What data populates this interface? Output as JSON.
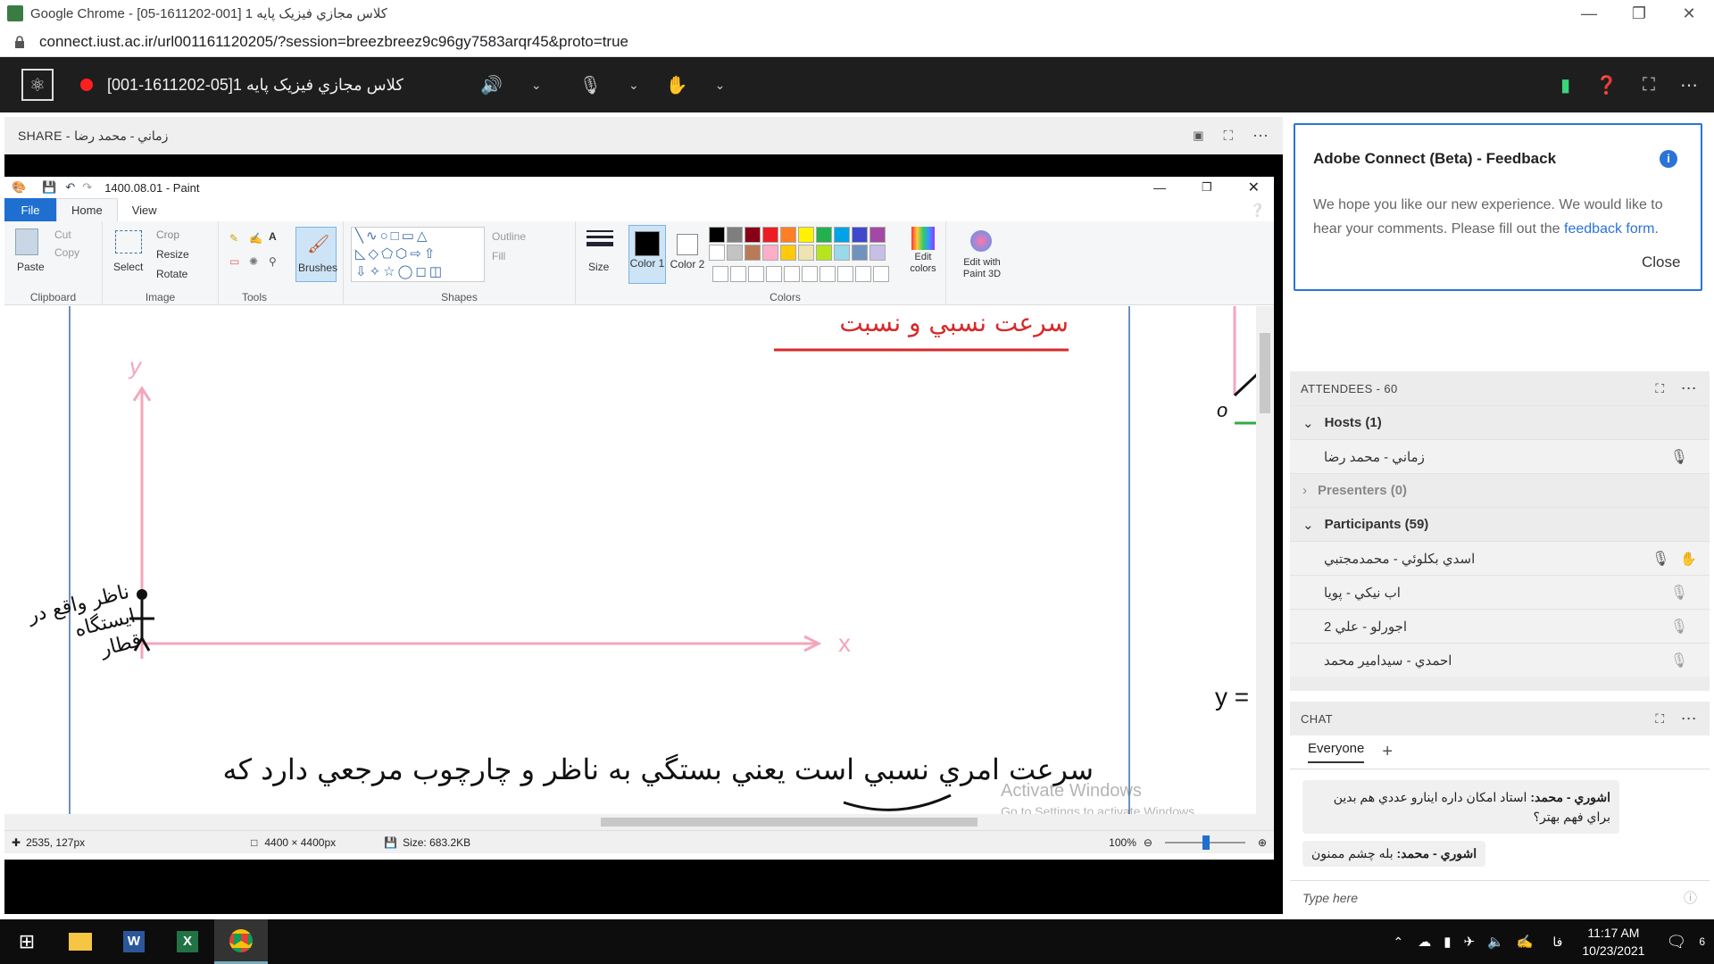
{
  "browser": {
    "title": "Google Chrome - [05-1611202-001] کلاس مجازي فيزيک پايه 1",
    "url": "connect.iust.ac.ir/url001161120205/?session=breezbreez9c96gy7583arqr45&proto=true"
  },
  "connect": {
    "room_title": "کلاس مجازي فيزيک پايه 1[05-1611202-001]",
    "share_label": "SHARE - زماني - محمد رضا"
  },
  "paint": {
    "title": "1400.08.01 - Paint",
    "menu": {
      "file": "File",
      "home": "Home",
      "view": "View"
    },
    "clipboard": {
      "paste": "Paste",
      "cut": "Cut",
      "copy": "Copy",
      "group": "Clipboard"
    },
    "image": {
      "select": "Select",
      "crop": "Crop",
      "resize": "Resize",
      "rotate": "Rotate",
      "group": "Image"
    },
    "tools": {
      "group": "Tools",
      "brushes": "Brushes"
    },
    "shapes": {
      "group": "Shapes",
      "outline": "Outline",
      "fill": "Fill"
    },
    "size": "Size",
    "color1": "Color 1",
    "color2": "Color 2",
    "colors_group": "Colors",
    "edit_colors": "Edit colors",
    "edit_paint3d": "Edit with Paint 3D",
    "palette": [
      "#000000",
      "#7f7f7f",
      "#880015",
      "#ed1c24",
      "#ff7f27",
      "#fff200",
      "#22b14c",
      "#00a2e8",
      "#3f48cc",
      "#a349a4",
      "#ffffff",
      "#c3c3c3",
      "#b97a57",
      "#ffaec9",
      "#ffc90e",
      "#efe4b0",
      "#b5e61d",
      "#99d9ea",
      "#7092be",
      "#c8bfe7"
    ],
    "status": {
      "coords": "2535, 127px",
      "dimensions": "4400 × 4400px",
      "size": "Size: 683.2KB",
      "zoom": "100%"
    },
    "watermark": {
      "line1": "Activate Windows",
      "line2": "Go to Settings to activate Windows."
    },
    "canvas_text": {
      "y_label": "y",
      "x_label": "x",
      "observer": "ناظر واقع در ايستگاه قطار",
      "bottom": "سرعت امري نسبي است يعني بستگي به ناظر و چارچوب مرجعي دارد كه",
      "top_right": "سرعت نسبي و نسبت",
      "o_label": "o",
      "y_eq": "y ="
    }
  },
  "feedback": {
    "title": "Adobe Connect (Beta) - Feedback",
    "body": "We hope you like our new experience. We would like to hear your comments. Please fill out the",
    "link": "feedback form",
    "period": ".",
    "close": "Close"
  },
  "attendees": {
    "header": "ATTENDEES - 60",
    "hosts": "Hosts (1)",
    "host_name": "زماني - محمد رضا",
    "presenters": "Presenters (0)",
    "participants": "Participants (59)",
    "people": [
      "اسدي بكلوئي - محمدمجتبي",
      "اب نيكي - پويا",
      "اجورلو - علي 2",
      "احمدي - سيدامير محمد"
    ]
  },
  "chat": {
    "header": "CHAT",
    "tab": "Everyone",
    "msgs": [
      {
        "sender": "اشوري - محمد:",
        "text": "استاد امكان داره اينارو عددي هم بدين براي فهم بهتر؟"
      },
      {
        "sender": "اشوري - محمد:",
        "text": "بله چشم ممنون"
      }
    ],
    "placeholder": "Type here"
  },
  "taskbar": {
    "time": "11:17 AM",
    "date": "10/23/2021",
    "lang": "فا",
    "notif": "6"
  },
  "colors": {
    "accent": "#2b73d7",
    "record": "#ff1f1f",
    "paint_file": "#1e6fd0"
  }
}
